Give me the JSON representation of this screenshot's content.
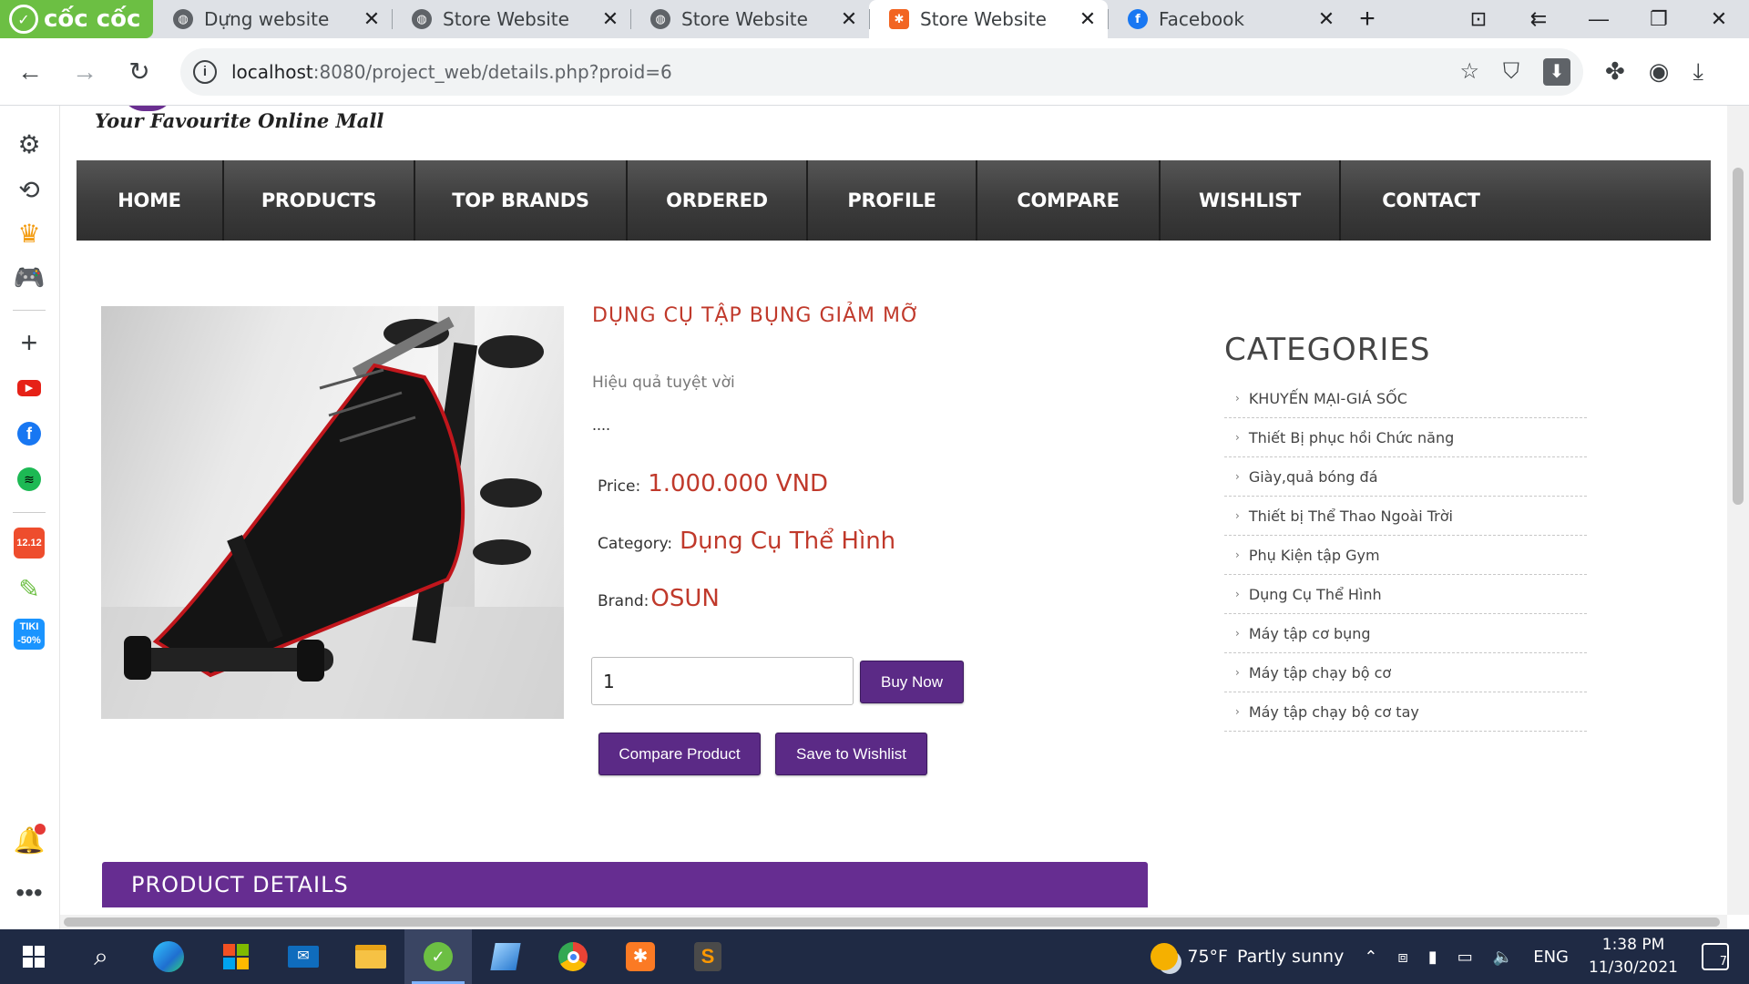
{
  "browser": {
    "brand": "cốc cốc",
    "tabs": [
      {
        "label": "Dựng website",
        "color": "#5f6368"
      },
      {
        "label": "Store Website",
        "color": "#5f6368"
      },
      {
        "label": "Store Website",
        "color": "#5f6368"
      },
      {
        "label": "Store Website",
        "color": "#f26522"
      },
      {
        "label": "Facebook",
        "color": "#1877f2"
      }
    ],
    "active_tab": 3,
    "url_host": "localhost",
    "url_path": ":8080/project_web/details.php?proid=6"
  },
  "site": {
    "tagline": "Your Favourite Online Mall",
    "menu": [
      "HOME",
      "PRODUCTS",
      "TOP BRANDS",
      "ORDERED",
      "PROFILE",
      "COMPARE",
      "WISHLIST",
      "CONTACT"
    ],
    "accent": "#662d91",
    "price_color": "#c0392b"
  },
  "product": {
    "title": "DỤNG CỤ TẬP BỤNG GIẢM MỠ",
    "description": "Hiệu quả tuyệt vời",
    "dots": "....",
    "price_label": "Price:",
    "price": "1.000.000 VND",
    "category_label": "Category:",
    "category": "Dụng Cụ Thể Hình",
    "brand_label": "Brand:",
    "brand": "OSUN",
    "quantity": "1",
    "buy_label": "Buy Now",
    "compare_label": "Compare Product",
    "wishlist_label": "Save to Wishlist"
  },
  "categories": {
    "title": "CATEGORIES",
    "items": [
      "KHUYẾN MẠI-GIÁ SỐC",
      "Thiết Bị phục hồi Chức năng",
      "Giày,quả bóng đá",
      "Thiết bị Thể Thao Ngoài Trời",
      "Phụ Kiện tập Gym",
      "Dụng Cụ Thể Hình",
      "Máy tập cơ bụng",
      "Máy tập chạy bộ cơ",
      "Máy tập chạy bộ cơ tay"
    ]
  },
  "details": {
    "title": "PRODUCT DETAILS"
  },
  "taskbar": {
    "temperature": "75°F",
    "weather": "Partly sunny",
    "language": "ENG",
    "time": "1:38 PM",
    "date": "11/30/2021",
    "notifications": "7"
  }
}
